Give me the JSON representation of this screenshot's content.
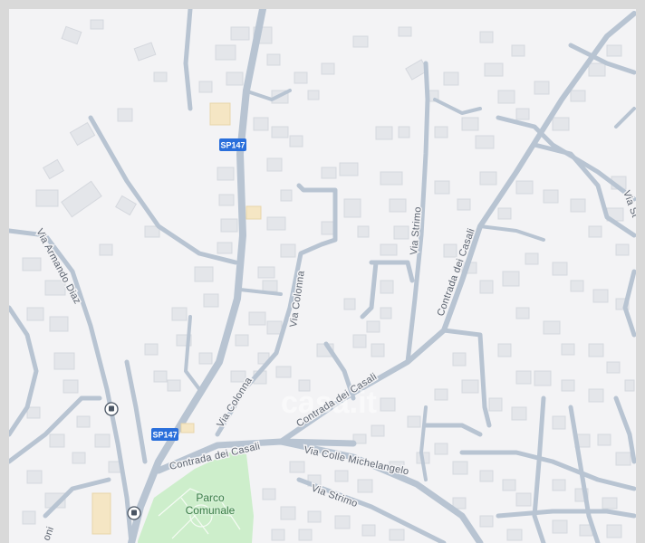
{
  "map": {
    "route_shield": "SP147",
    "streets": {
      "armando_diaz": "Via Armando Diaz",
      "colonna_upper": "Via Colonna",
      "colonna_lower": "Via Colonna",
      "strimo_upper": "Via Strimo",
      "strimo_lower": "Via Strimo",
      "casali_upper": "Contrada dei Casali",
      "casali_mid": "Contrada dei Casali",
      "casali_lower": "Contrada dei Casali",
      "colle_michelangelo": "Via Colle Michelangelo",
      "edge_right": "Via St",
      "edge_left": "oni"
    },
    "park": {
      "name_line1": "Parco",
      "name_line2": "Comunale"
    },
    "watermark": "casa.it",
    "colors": {
      "background": "#f3f3f5",
      "road": "#b8c4d2",
      "building": "#e4e6ea",
      "park": "#cdeecb",
      "shield": "#2a6fdb",
      "highlight_building": "#f5e6c4"
    },
    "icons": [
      "bus-stop-icon",
      "bus-stop-icon"
    ]
  }
}
